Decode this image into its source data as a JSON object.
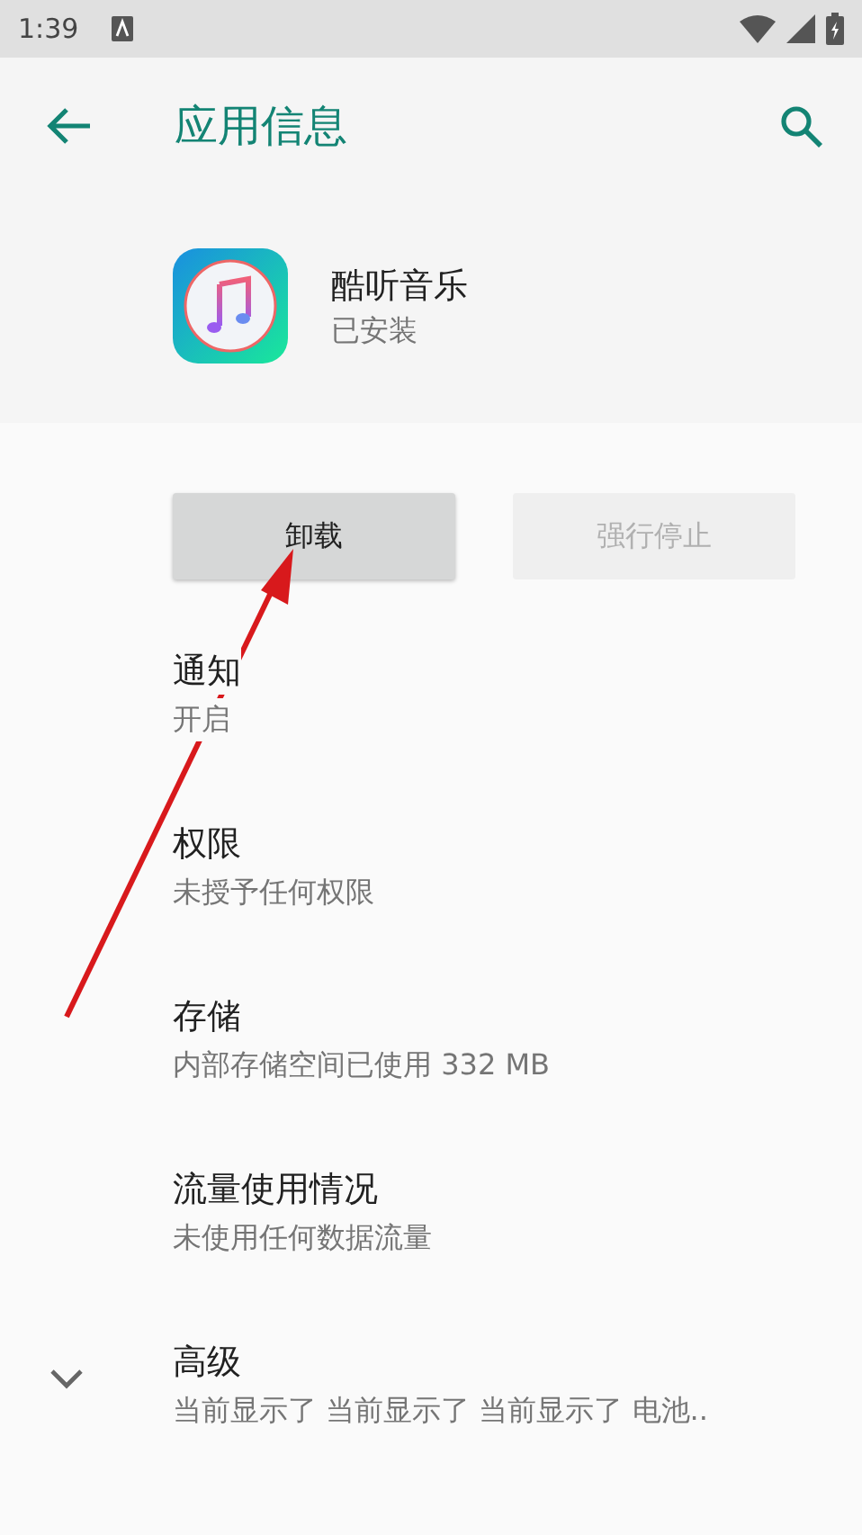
{
  "status_bar": {
    "time": "1:39"
  },
  "app_bar": {
    "title": "应用信息"
  },
  "app": {
    "name": "酷听音乐",
    "status": "已安装"
  },
  "buttons": [
    {
      "label": "卸载",
      "disabled": false
    },
    {
      "label": "强行停止",
      "disabled": true
    }
  ],
  "items": [
    {
      "kind": "plain",
      "title": "通知",
      "summary": "开启"
    },
    {
      "kind": "plain",
      "title": "权限",
      "summary": "未授予任何权限"
    },
    {
      "kind": "plain",
      "title": "存储",
      "summary": "内部存储空间已使用 332 MB"
    },
    {
      "kind": "plain",
      "title": "流量使用情况",
      "summary": "未使用任何数据流量"
    },
    {
      "kind": "expand",
      "title": "高级",
      "summary": "当前显示了 当前显示了 当前显示了 电池.."
    }
  ]
}
